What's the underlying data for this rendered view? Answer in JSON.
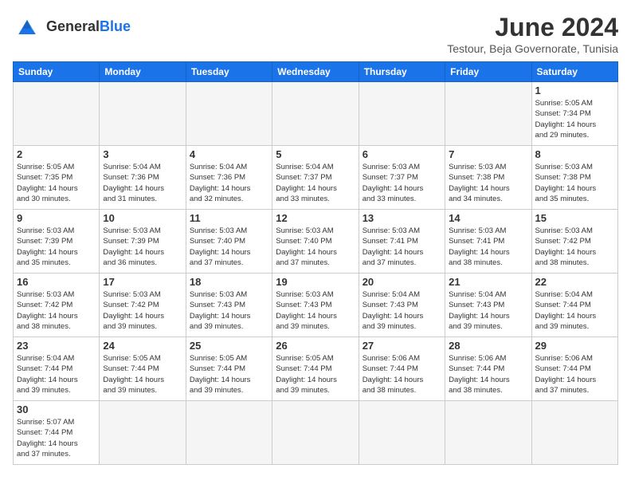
{
  "header": {
    "logo_general": "General",
    "logo_blue": "Blue",
    "month_title": "June 2024",
    "subtitle": "Testour, Beja Governorate, Tunisia"
  },
  "weekdays": [
    "Sunday",
    "Monday",
    "Tuesday",
    "Wednesday",
    "Thursday",
    "Friday",
    "Saturday"
  ],
  "weeks": [
    [
      {
        "day": "",
        "info": ""
      },
      {
        "day": "",
        "info": ""
      },
      {
        "day": "",
        "info": ""
      },
      {
        "day": "",
        "info": ""
      },
      {
        "day": "",
        "info": ""
      },
      {
        "day": "",
        "info": ""
      },
      {
        "day": "1",
        "info": "Sunrise: 5:05 AM\nSunset: 7:34 PM\nDaylight: 14 hours\nand 29 minutes."
      }
    ],
    [
      {
        "day": "2",
        "info": "Sunrise: 5:05 AM\nSunset: 7:35 PM\nDaylight: 14 hours\nand 30 minutes."
      },
      {
        "day": "3",
        "info": "Sunrise: 5:04 AM\nSunset: 7:36 PM\nDaylight: 14 hours\nand 31 minutes."
      },
      {
        "day": "4",
        "info": "Sunrise: 5:04 AM\nSunset: 7:36 PM\nDaylight: 14 hours\nand 32 minutes."
      },
      {
        "day": "5",
        "info": "Sunrise: 5:04 AM\nSunset: 7:37 PM\nDaylight: 14 hours\nand 33 minutes."
      },
      {
        "day": "6",
        "info": "Sunrise: 5:03 AM\nSunset: 7:37 PM\nDaylight: 14 hours\nand 33 minutes."
      },
      {
        "day": "7",
        "info": "Sunrise: 5:03 AM\nSunset: 7:38 PM\nDaylight: 14 hours\nand 34 minutes."
      },
      {
        "day": "8",
        "info": "Sunrise: 5:03 AM\nSunset: 7:38 PM\nDaylight: 14 hours\nand 35 minutes."
      }
    ],
    [
      {
        "day": "9",
        "info": "Sunrise: 5:03 AM\nSunset: 7:39 PM\nDaylight: 14 hours\nand 35 minutes."
      },
      {
        "day": "10",
        "info": "Sunrise: 5:03 AM\nSunset: 7:39 PM\nDaylight: 14 hours\nand 36 minutes."
      },
      {
        "day": "11",
        "info": "Sunrise: 5:03 AM\nSunset: 7:40 PM\nDaylight: 14 hours\nand 37 minutes."
      },
      {
        "day": "12",
        "info": "Sunrise: 5:03 AM\nSunset: 7:40 PM\nDaylight: 14 hours\nand 37 minutes."
      },
      {
        "day": "13",
        "info": "Sunrise: 5:03 AM\nSunset: 7:41 PM\nDaylight: 14 hours\nand 37 minutes."
      },
      {
        "day": "14",
        "info": "Sunrise: 5:03 AM\nSunset: 7:41 PM\nDaylight: 14 hours\nand 38 minutes."
      },
      {
        "day": "15",
        "info": "Sunrise: 5:03 AM\nSunset: 7:42 PM\nDaylight: 14 hours\nand 38 minutes."
      }
    ],
    [
      {
        "day": "16",
        "info": "Sunrise: 5:03 AM\nSunset: 7:42 PM\nDaylight: 14 hours\nand 38 minutes."
      },
      {
        "day": "17",
        "info": "Sunrise: 5:03 AM\nSunset: 7:42 PM\nDaylight: 14 hours\nand 39 minutes."
      },
      {
        "day": "18",
        "info": "Sunrise: 5:03 AM\nSunset: 7:43 PM\nDaylight: 14 hours\nand 39 minutes."
      },
      {
        "day": "19",
        "info": "Sunrise: 5:03 AM\nSunset: 7:43 PM\nDaylight: 14 hours\nand 39 minutes."
      },
      {
        "day": "20",
        "info": "Sunrise: 5:04 AM\nSunset: 7:43 PM\nDaylight: 14 hours\nand 39 minutes."
      },
      {
        "day": "21",
        "info": "Sunrise: 5:04 AM\nSunset: 7:43 PM\nDaylight: 14 hours\nand 39 minutes."
      },
      {
        "day": "22",
        "info": "Sunrise: 5:04 AM\nSunset: 7:44 PM\nDaylight: 14 hours\nand 39 minutes."
      }
    ],
    [
      {
        "day": "23",
        "info": "Sunrise: 5:04 AM\nSunset: 7:44 PM\nDaylight: 14 hours\nand 39 minutes."
      },
      {
        "day": "24",
        "info": "Sunrise: 5:05 AM\nSunset: 7:44 PM\nDaylight: 14 hours\nand 39 minutes."
      },
      {
        "day": "25",
        "info": "Sunrise: 5:05 AM\nSunset: 7:44 PM\nDaylight: 14 hours\nand 39 minutes."
      },
      {
        "day": "26",
        "info": "Sunrise: 5:05 AM\nSunset: 7:44 PM\nDaylight: 14 hours\nand 39 minutes."
      },
      {
        "day": "27",
        "info": "Sunrise: 5:06 AM\nSunset: 7:44 PM\nDaylight: 14 hours\nand 38 minutes."
      },
      {
        "day": "28",
        "info": "Sunrise: 5:06 AM\nSunset: 7:44 PM\nDaylight: 14 hours\nand 38 minutes."
      },
      {
        "day": "29",
        "info": "Sunrise: 5:06 AM\nSunset: 7:44 PM\nDaylight: 14 hours\nand 37 minutes."
      }
    ],
    [
      {
        "day": "30",
        "info": "Sunrise: 5:07 AM\nSunset: 7:44 PM\nDaylight: 14 hours\nand 37 minutes."
      },
      {
        "day": "",
        "info": ""
      },
      {
        "day": "",
        "info": ""
      },
      {
        "day": "",
        "info": ""
      },
      {
        "day": "",
        "info": ""
      },
      {
        "day": "",
        "info": ""
      },
      {
        "day": "",
        "info": ""
      }
    ]
  ]
}
